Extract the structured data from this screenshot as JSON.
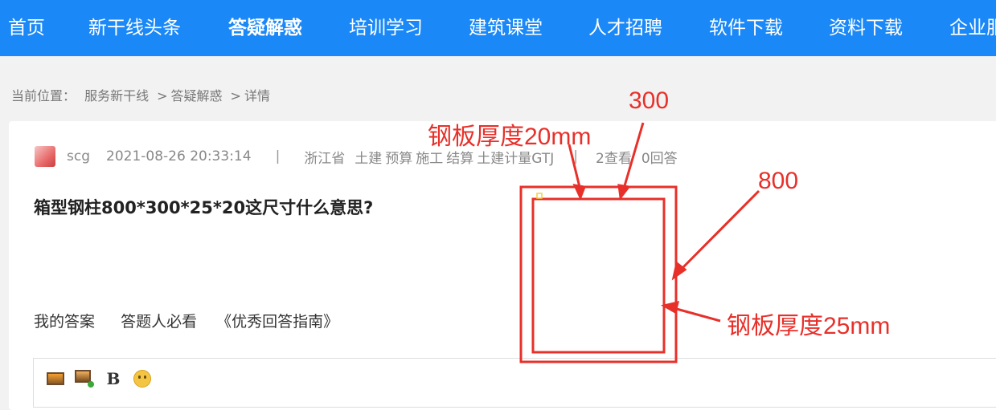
{
  "nav": {
    "items": [
      {
        "label": "首页",
        "active": false
      },
      {
        "label": "新干线头条",
        "active": false
      },
      {
        "label": "答疑解惑",
        "active": true
      },
      {
        "label": "培训学习",
        "active": false
      },
      {
        "label": "建筑课堂",
        "active": false
      },
      {
        "label": "人才招聘",
        "active": false
      },
      {
        "label": "软件下载",
        "active": false
      },
      {
        "label": "资料下载",
        "active": false
      },
      {
        "label": "企业服",
        "active": false
      }
    ],
    "bg_color": "#1a88f7"
  },
  "breadcrumb": {
    "prefix": "当前位置：",
    "items": [
      "服务新干线",
      "答疑解惑",
      "详情"
    ],
    "separator": ">"
  },
  "post": {
    "username": "scg",
    "datetime": "2021-08-26 20:33:14",
    "divider": "|",
    "region": "浙江省",
    "tags": [
      "土建",
      "预算",
      "施工",
      "结算",
      "土建计量GTJ"
    ],
    "views": "2查看",
    "answers": "0回答",
    "question": "箱型钢柱800*300*25*20这尺寸什么意思?"
  },
  "answer_bar": {
    "my_answer": "我的答案",
    "must_read": "答题人必看",
    "guide": "《优秀回答指南》"
  },
  "editor": {
    "toolbar_icons": [
      "image-icon",
      "multi-image-icon",
      "bold-icon",
      "emoji-icon"
    ],
    "bold_glyph": "B"
  },
  "annotation": {
    "color": "#e8302a",
    "labels": {
      "top_thickness": "钢板厚度20mm",
      "width": "300",
      "height": "800",
      "side_thickness": "钢板厚度25mm"
    }
  }
}
